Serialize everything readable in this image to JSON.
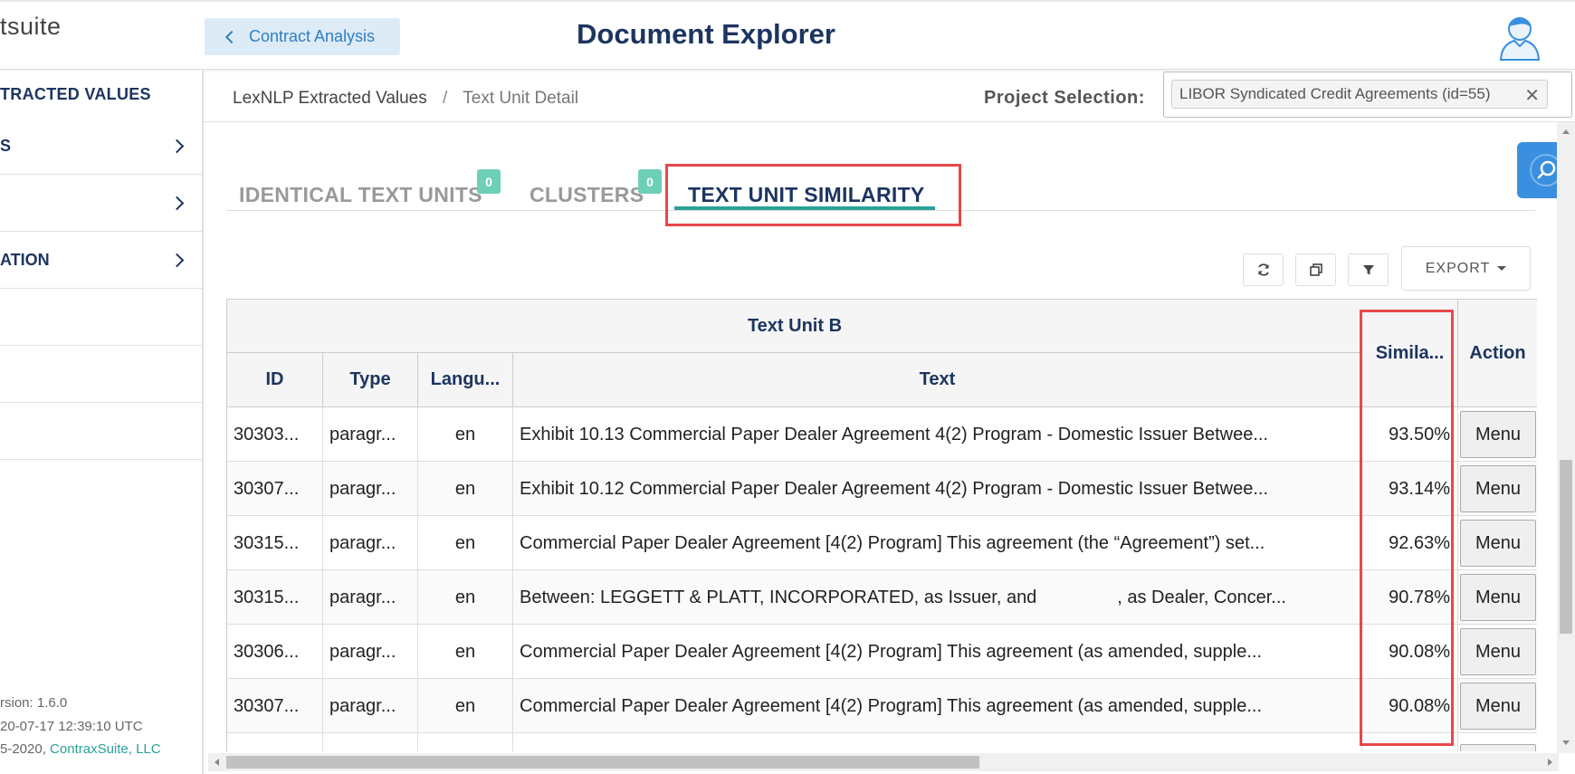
{
  "header": {
    "logo_text": "tsuite",
    "back_label": "Contract Analysis",
    "title": "Document Explorer"
  },
  "sidebar": {
    "heading": "TRACTED VALUES",
    "items": [
      {
        "label": "S"
      },
      {
        "label": ""
      },
      {
        "label": "ATION"
      }
    ],
    "footer": {
      "version": "rsion: 1.6.0",
      "build_date": "20-07-17 12:39:10 UTC",
      "copyright": "5-2020, ",
      "company": "ContraxSuite, LLC"
    }
  },
  "breadcrumb": {
    "parent": "LexNLP Extracted Values",
    "separator": "/",
    "current": "Text Unit Detail"
  },
  "project": {
    "label": "Project Selection:",
    "selected": "LIBOR Syndicated Credit Agreements (id=55)"
  },
  "tabs": [
    {
      "label": "IDENTICAL TEXT UNITS",
      "badge": "0"
    },
    {
      "label": "CLUSTERS",
      "badge": "0"
    },
    {
      "label": "TEXT UNIT SIMILARITY",
      "active": true
    }
  ],
  "toolbar": {
    "export_label": "EXPORT"
  },
  "table": {
    "group_header": "Text Unit B",
    "columns": {
      "id": "ID",
      "type": "Type",
      "language": "Langu...",
      "text": "Text",
      "similarity": "Simila...",
      "action": "Action"
    },
    "rows": [
      {
        "id": "30303...",
        "type": "paragr...",
        "language": "en",
        "text": "Exhibit 10.13 Commercial Paper Dealer Agreement 4(2) Program - Domestic Issuer Betwee...",
        "similarity": "93.50%",
        "action": "Menu"
      },
      {
        "id": "30307...",
        "type": "paragr...",
        "language": "en",
        "text": "Exhibit 10.12 Commercial Paper Dealer Agreement 4(2) Program - Domestic Issuer Betwee...",
        "similarity": "93.14%",
        "action": "Menu"
      },
      {
        "id": "30315...",
        "type": "paragr...",
        "language": "en",
        "text": "Commercial Paper Dealer Agreement [4(2) Program] This agreement (the “Agreement”) set...",
        "similarity": "92.63%",
        "action": "Menu"
      },
      {
        "id": "30315...",
        "type": "paragr...",
        "language": "en",
        "text": "Between: LEGGETT & PLATT, INCORPORATED, as Issuer, and                , as Dealer, Concer...",
        "similarity": "90.78%",
        "action": "Menu"
      },
      {
        "id": "30306...",
        "type": "paragr...",
        "language": "en",
        "text": "Commercial Paper Dealer Agreement [4(2) Program] This agreement (as amended, supple...",
        "similarity": "90.08%",
        "action": "Menu"
      },
      {
        "id": "30307...",
        "type": "paragr...",
        "language": "en",
        "text": "Commercial Paper Dealer Agreement [4(2) Program] This agreement (as amended, supple...",
        "similarity": "90.08%",
        "action": "Menu"
      }
    ]
  },
  "colors": {
    "navy": "#1c3560",
    "teal": "#2aa198",
    "badge": "#6ecfb8",
    "highlight": "#e8474b",
    "search_button": "#3a8fe0"
  }
}
